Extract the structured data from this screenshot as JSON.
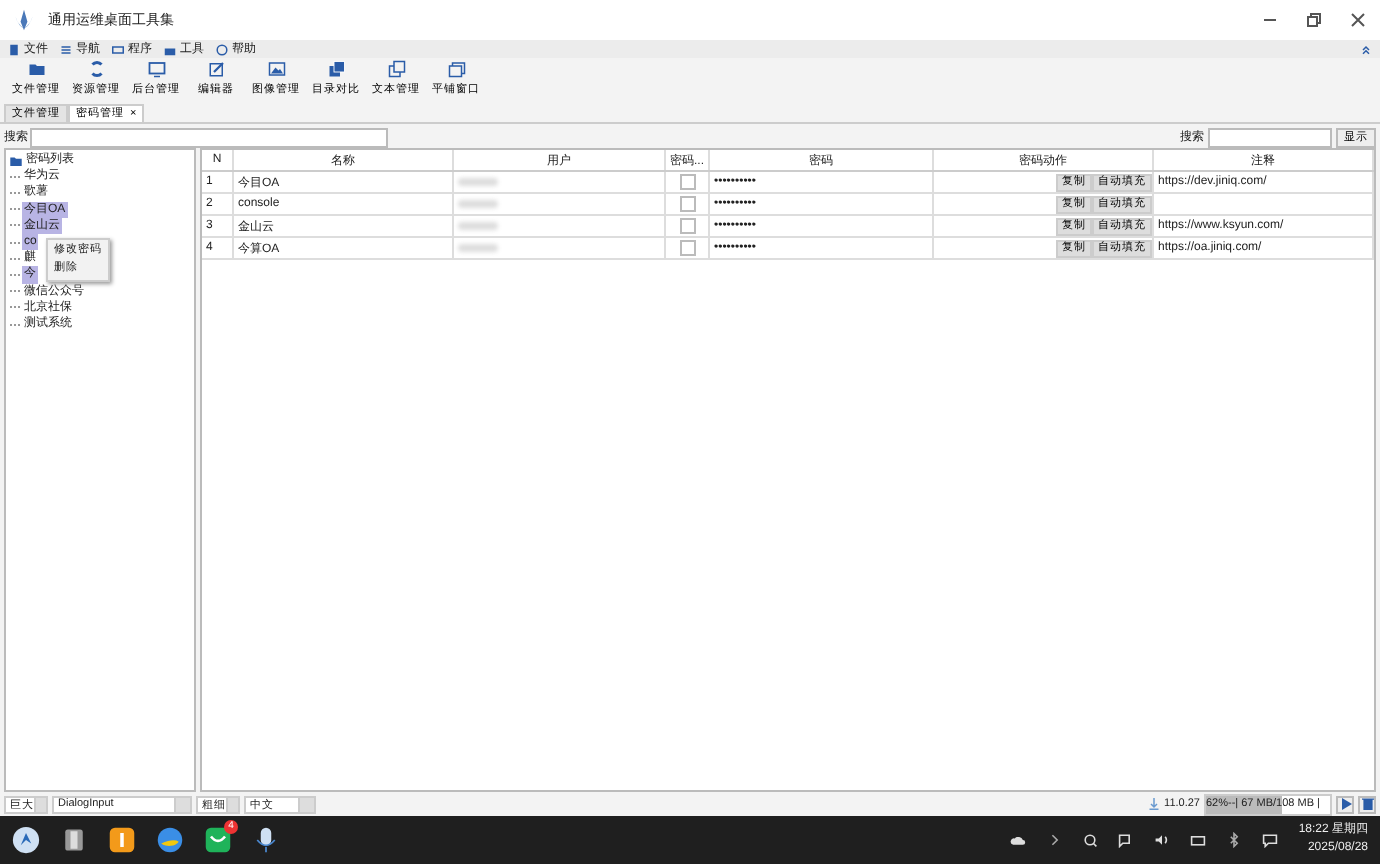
{
  "window": {
    "title": "通用运维桌面工具集"
  },
  "menu": [
    {
      "label": "文件"
    },
    {
      "label": "导航"
    },
    {
      "label": "程序"
    },
    {
      "label": "工具"
    },
    {
      "label": "帮助"
    }
  ],
  "toolbar": [
    {
      "label": "文件管理"
    },
    {
      "label": "资源管理"
    },
    {
      "label": "后台管理"
    },
    {
      "label": "编辑器"
    },
    {
      "label": "图像管理"
    },
    {
      "label": "目录对比"
    },
    {
      "label": "文本管理"
    },
    {
      "label": "平铺窗口"
    }
  ],
  "tabs": [
    {
      "label": "文件管理",
      "selected": false
    },
    {
      "label": "密码管理",
      "selected": true,
      "close": "×"
    }
  ],
  "tree": {
    "search_label": "搜索",
    "root": {
      "label": "密码列表",
      "expanded": true,
      "children": [
        {
          "label": "华为云",
          "selected": false
        },
        {
          "label": "歌薯",
          "selected": false
        },
        {
          "label": "今目OA",
          "selected": true
        },
        {
          "label": "金山云",
          "selected": true
        },
        {
          "label": "co",
          "selected": true
        },
        {
          "label": "麒",
          "selected": false
        },
        {
          "label": "今",
          "selected": true
        },
        {
          "label": "微信公众号",
          "selected": false
        },
        {
          "label": "北京社保",
          "selected": false
        },
        {
          "label": "测试系统",
          "selected": false
        }
      ]
    }
  },
  "context_menu": [
    {
      "label": "修改密码"
    },
    {
      "label": "删除"
    }
  ],
  "table": {
    "search_label": "搜索",
    "show_button": "显示",
    "columns": [
      "N",
      "名称",
      "用户",
      "密码...",
      "密码",
      "密码动作",
      "注释"
    ],
    "rows": [
      {
        "n": "1",
        "name": "今目OA",
        "checked": false,
        "password": "••••••••••",
        "actions": [
          "复制",
          "自动填充"
        ],
        "note": "https://dev.jiniq.com/"
      },
      {
        "n": "2",
        "name": "console",
        "checked": false,
        "password": "••••••••••",
        "actions": [
          "复制",
          "自动填充"
        ]
      },
      {
        "n": "3",
        "name": "金山云",
        "checked": false,
        "password": "••••••••••",
        "actions": [
          "复制",
          "自动填充"
        ],
        "note": "https://www.ksyun.com/"
      },
      {
        "n": "4",
        "name": "今算OA",
        "checked": false,
        "password": "••••••••••",
        "actions": [
          "复制",
          "自动填充"
        ],
        "note": "https://oa.jiniq.com/"
      }
    ]
  },
  "status_bar": {
    "font_size": "巨大",
    "font": "DialogInput",
    "weight": "粗细",
    "language": "中文",
    "version": "11.0.27",
    "memory": "62%--| 67 MB/108 MB |",
    "level": 0.62
  },
  "taskbar": {
    "badge": "4",
    "time": "18:22 星期四",
    "date": "2025/08/28"
  }
}
